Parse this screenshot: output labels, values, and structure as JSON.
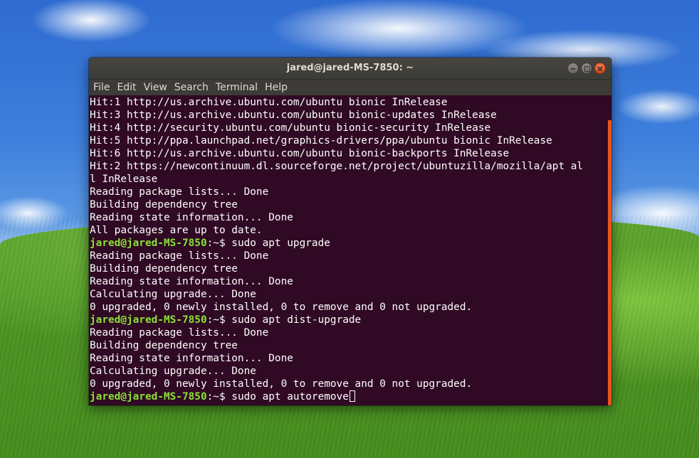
{
  "window": {
    "title": "jared@jared-MS-7850: ~"
  },
  "menu": [
    "File",
    "Edit",
    "View",
    "Search",
    "Terminal",
    "Help"
  ],
  "terminal": {
    "prompt_user": "jared@jared-MS-7850",
    "prompt_suffix": ":~$ ",
    "lines": [
      {
        "type": "out",
        "text": "Hit:1 http://us.archive.ubuntu.com/ubuntu bionic InRelease"
      },
      {
        "type": "out",
        "text": "Hit:3 http://us.archive.ubuntu.com/ubuntu bionic-updates InRelease"
      },
      {
        "type": "out",
        "text": "Hit:4 http://security.ubuntu.com/ubuntu bionic-security InRelease"
      },
      {
        "type": "out",
        "text": "Hit:5 http://ppa.launchpad.net/graphics-drivers/ppa/ubuntu bionic InRelease"
      },
      {
        "type": "out",
        "text": "Hit:6 http://us.archive.ubuntu.com/ubuntu bionic-backports InRelease"
      },
      {
        "type": "out",
        "text": "Hit:2 https://newcontinuum.dl.sourceforge.net/project/ubuntuzilla/mozilla/apt al"
      },
      {
        "type": "out",
        "text": "l InRelease"
      },
      {
        "type": "out",
        "text": "Reading package lists... Done"
      },
      {
        "type": "out",
        "text": "Building dependency tree"
      },
      {
        "type": "out",
        "text": "Reading state information... Done"
      },
      {
        "type": "out",
        "text": "All packages are up to date."
      },
      {
        "type": "cmd",
        "text": "sudo apt upgrade"
      },
      {
        "type": "out",
        "text": "Reading package lists... Done"
      },
      {
        "type": "out",
        "text": "Building dependency tree"
      },
      {
        "type": "out",
        "text": "Reading state information... Done"
      },
      {
        "type": "out",
        "text": "Calculating upgrade... Done"
      },
      {
        "type": "out",
        "text": "0 upgraded, 0 newly installed, 0 to remove and 0 not upgraded."
      },
      {
        "type": "cmd",
        "text": "sudo apt dist-upgrade"
      },
      {
        "type": "out",
        "text": "Reading package lists... Done"
      },
      {
        "type": "out",
        "text": "Building dependency tree"
      },
      {
        "type": "out",
        "text": "Reading state information... Done"
      },
      {
        "type": "out",
        "text": "Calculating upgrade... Done"
      },
      {
        "type": "out",
        "text": "0 upgraded, 0 newly installed, 0 to remove and 0 not upgraded."
      },
      {
        "type": "current",
        "text": "sudo apt autoremove"
      }
    ]
  },
  "colors": {
    "terminal_bg": "#300a24",
    "prompt": "#8ae234",
    "scrollbar": "#e95420",
    "close_button": "#dd4814"
  }
}
